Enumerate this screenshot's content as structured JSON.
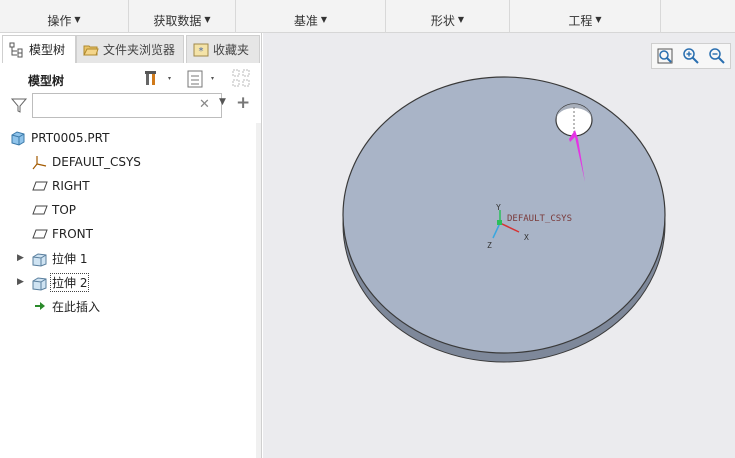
{
  "ribbon": {
    "groups": [
      {
        "label": "操作"
      },
      {
        "label": "获取数据"
      },
      {
        "label": "基准"
      },
      {
        "label": "形状"
      },
      {
        "label": "工程"
      }
    ]
  },
  "left_panel": {
    "tabs": [
      {
        "label": "模型树",
        "icon": "model-tree-icon",
        "active": true
      },
      {
        "label": "文件夹浏览器",
        "icon": "folder-icon",
        "active": false
      },
      {
        "label": "收藏夹",
        "icon": "favorites-icon",
        "active": false
      }
    ],
    "tree_title": "模型树",
    "filter": {
      "value": "",
      "placeholder": ""
    },
    "tree_items": [
      {
        "label": "PRT0005.PRT",
        "icon": "part-icon",
        "expandable": false
      },
      {
        "label": "DEFAULT_CSYS",
        "icon": "csys-icon",
        "expandable": false
      },
      {
        "label": "RIGHT",
        "icon": "datum-plane-icon",
        "expandable": false
      },
      {
        "label": "TOP",
        "icon": "datum-plane-icon",
        "expandable": false
      },
      {
        "label": "FRONT",
        "icon": "datum-plane-icon",
        "expandable": false
      },
      {
        "label": "拉伸 1",
        "icon": "extrude-icon",
        "expandable": true
      },
      {
        "label": "拉伸 2",
        "icon": "extrude-icon",
        "expandable": true
      },
      {
        "label": "在此插入",
        "icon": "insert-here-icon",
        "expandable": false
      }
    ]
  },
  "viewport": {
    "csys_label": "DEFAULT_CSYS",
    "axis_x": "X",
    "axis_y": "Y",
    "axis_z": "Z",
    "colors": {
      "part_face": "#a9b4c7",
      "part_edge": "#3a3a3a",
      "part_side": "#7e889a",
      "arrow": "#e533e5",
      "background": "#ebebee"
    },
    "view_tools": [
      {
        "icon": "refit-icon"
      },
      {
        "icon": "zoom-in-icon"
      },
      {
        "icon": "zoom-out-icon"
      }
    ]
  }
}
